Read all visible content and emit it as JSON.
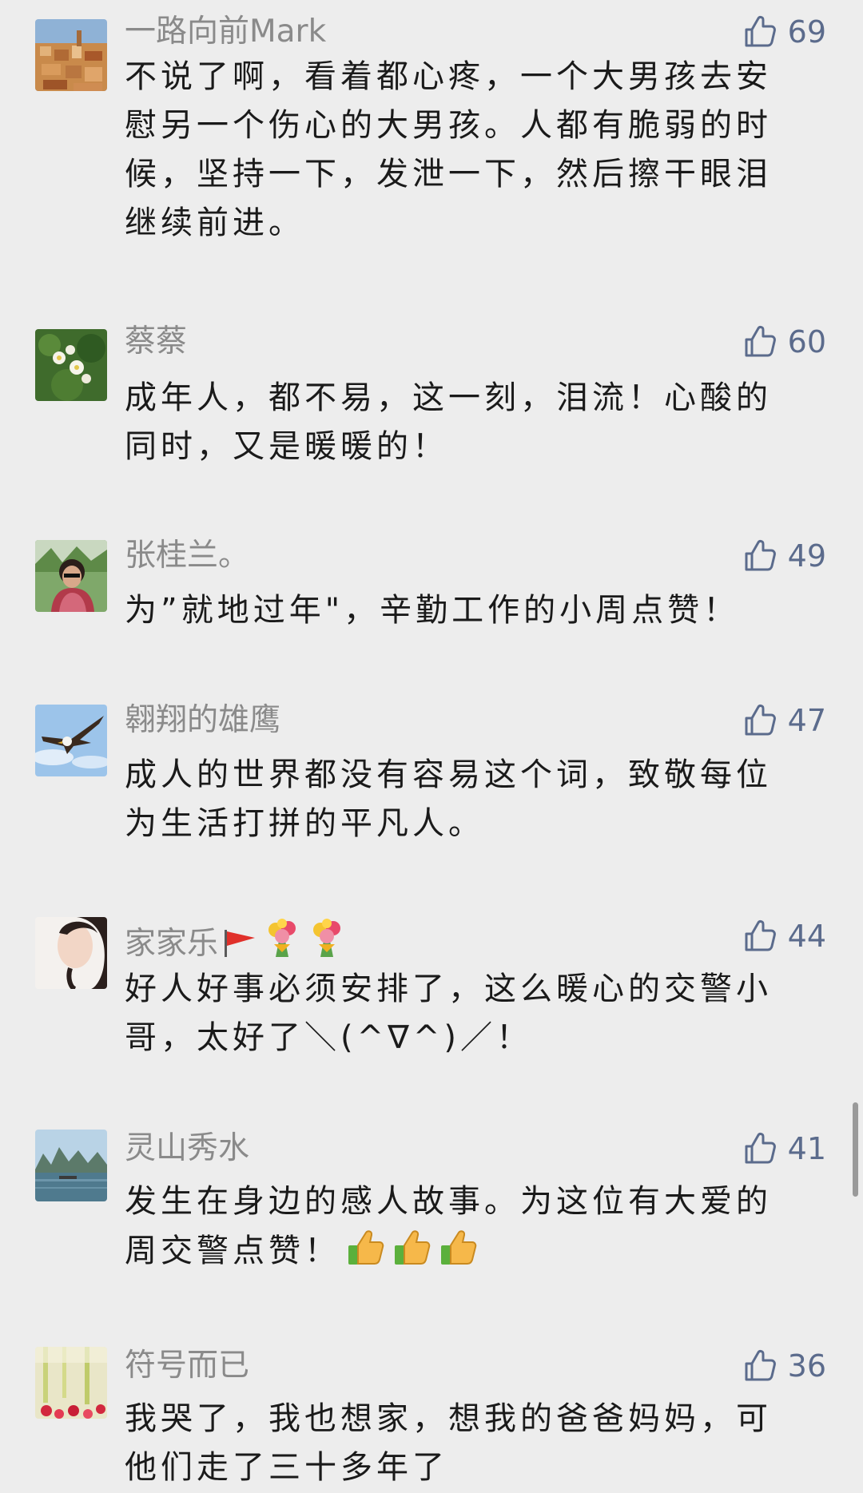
{
  "comments": [
    {
      "nickname": "一路向前Mark",
      "likes": "69",
      "lines": [
        "不说了啊，看着都心疼，一个大男孩去安",
        "慰另一个伤心的大男孩。人都有脆弱的时",
        "候，坚持一下，发泄一下，然后擦干眼泪",
        "继续前进。"
      ]
    },
    {
      "nickname": "蔡蔡",
      "likes": "60",
      "lines": [
        "成年人，都不易，这一刻，泪流！心酸的",
        "同时，又是暖暖的！"
      ]
    },
    {
      "nickname": "张桂兰。",
      "likes": "49",
      "lines": [
        "为”就地过年\"，辛勤工作的小周点赞！"
      ]
    },
    {
      "nickname": "翱翔的雄鹰",
      "likes": "47",
      "lines": [
        "成人的世界都没有容易这个词，致敬每位",
        "为生活打拼的平凡人。"
      ]
    },
    {
      "nickname": "家家乐",
      "likes": "44",
      "lines": [
        "好人好事必须安排了，这么暖心的交警小",
        "哥，太好了＼(^∇^)／！"
      ]
    },
    {
      "nickname": "灵山秀水",
      "likes": "41",
      "lines": [
        "发生在身边的感人故事。为这位有大爱的",
        "周交警点赞！"
      ]
    },
    {
      "nickname": "符号而已",
      "likes": "36",
      "lines": [
        "我哭了，我也想家，想我的爸爸妈妈，可",
        "他们走了三十多年了"
      ]
    }
  ],
  "icons": {
    "like": "thumbs-up-outline-icon",
    "nickname_emoji": [
      "red-flag-icon",
      "bouquet-icon",
      "bouquet-icon"
    ],
    "comment_emoji": [
      "thumbs-up-emoji-icon",
      "thumbs-up-emoji-icon",
      "thumbs-up-emoji-icon"
    ]
  },
  "colors": {
    "background": "#ededed",
    "nickname": "#8a8a8a",
    "like_count": "#5b6b8c",
    "body_text": "#1a1a1a"
  }
}
